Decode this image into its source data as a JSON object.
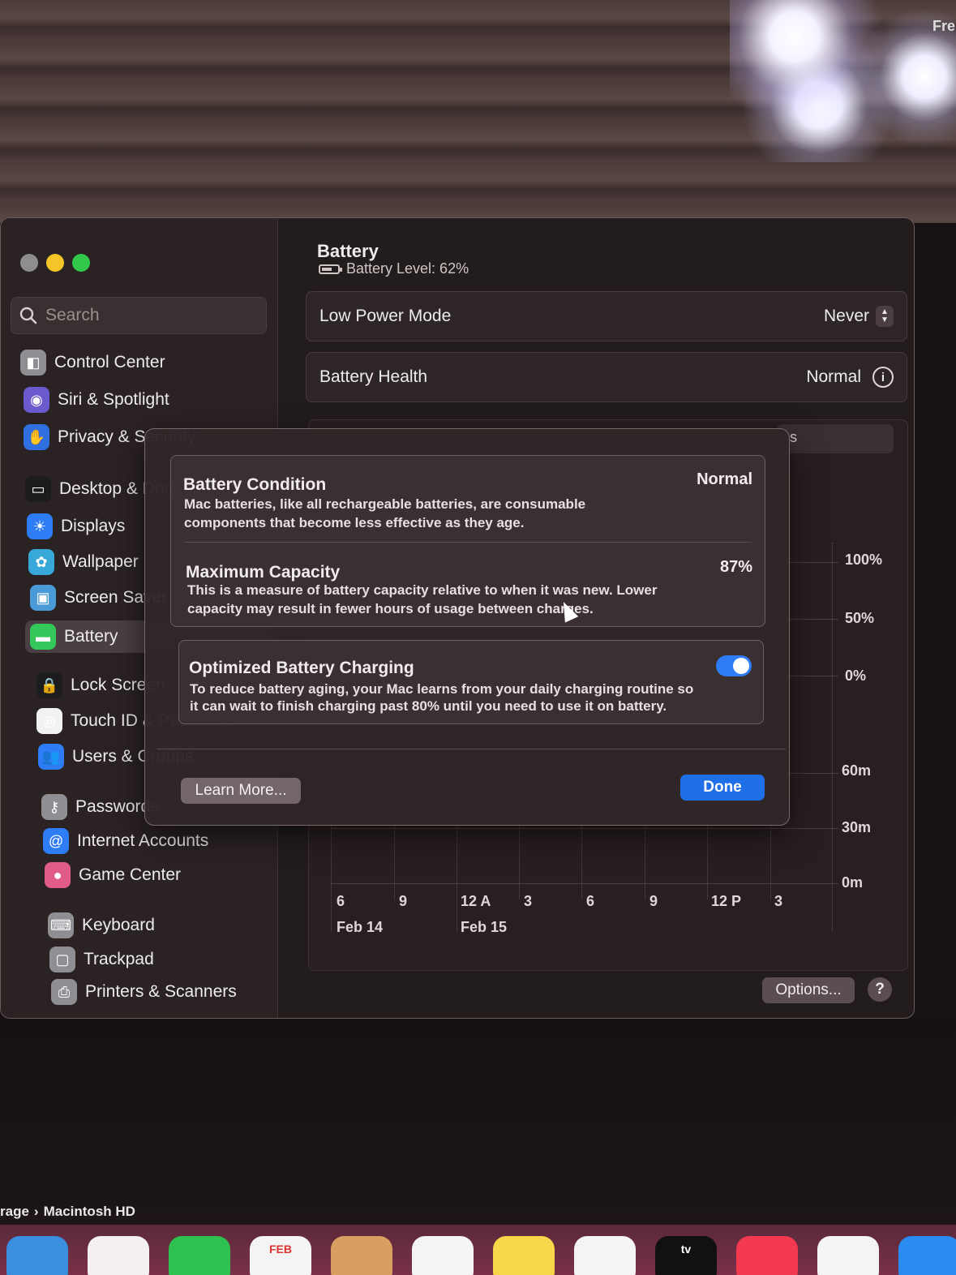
{
  "background": {
    "corner_text": "Fre",
    "finder_path": [
      "rage",
      "Macintosh HD"
    ],
    "finder_separator": "›"
  },
  "dock": {
    "items": [
      {
        "name": "maps-icon",
        "glyph": "",
        "color": "#3a8fe0"
      },
      {
        "name": "photos-icon",
        "glyph": "",
        "color": "#f5f0f0"
      },
      {
        "name": "facetime-icon",
        "glyph": "",
        "color": "#2fc14f"
      },
      {
        "name": "calendar-icon",
        "glyph": "FEB",
        "color": "#f4f4f4"
      },
      {
        "name": "contacts-icon",
        "glyph": "",
        "color": "#d8a060"
      },
      {
        "name": "reminders-icon",
        "glyph": "",
        "color": "#f4f4f4"
      },
      {
        "name": "notes-icon",
        "glyph": "",
        "color": "#f7d64a"
      },
      {
        "name": "freeform-icon",
        "glyph": "",
        "color": "#f4f4f4"
      },
      {
        "name": "apple-tv-icon",
        "glyph": "tv",
        "color": "#111111"
      },
      {
        "name": "music-icon",
        "glyph": "",
        "color": "#f2394f"
      },
      {
        "name": "news-icon",
        "glyph": "",
        "color": "#f4f4f4"
      },
      {
        "name": "app-store-icon",
        "glyph": "",
        "color": "#2a8cf0"
      }
    ]
  },
  "sidebar": {
    "search_placeholder": "Search",
    "items": [
      {
        "label": "Control Center",
        "icon": "control-center-icon",
        "color": "#8e8e93",
        "glyph": "◧"
      },
      {
        "label": "Siri & Spotlight",
        "icon": "siri-icon",
        "color": "#6a5acd",
        "glyph": "◉"
      },
      {
        "label": "Privacy & Security",
        "icon": "hand-icon",
        "color": "#2f6fe0",
        "glyph": "✋"
      },
      {
        "label": "Desktop & Dock",
        "icon": "dock-icon",
        "color": "#1c1c1e",
        "glyph": "▭"
      },
      {
        "label": "Displays",
        "icon": "sun-icon",
        "color": "#2f7df6",
        "glyph": "☀"
      },
      {
        "label": "Wallpaper",
        "icon": "wallpaper-icon",
        "color": "#38a8d8",
        "glyph": "✿"
      },
      {
        "label": "Screen Saver",
        "icon": "screen-saver-icon",
        "color": "#4a9ad8",
        "glyph": "▣"
      },
      {
        "label": "Battery",
        "icon": "battery-icon",
        "color": "#34c759",
        "glyph": "▬"
      },
      {
        "label": "Lock Screen",
        "icon": "lock-icon",
        "color": "#1c1c1e",
        "glyph": "🔒"
      },
      {
        "label": "Touch ID & Password",
        "icon": "fingerprint-icon",
        "color": "#f2f2f2",
        "glyph": "◎"
      },
      {
        "label": "Users & Groups",
        "icon": "users-icon",
        "color": "#2f7df6",
        "glyph": "👥"
      },
      {
        "label": "Passwords",
        "icon": "key-icon",
        "color": "#8e8e93",
        "glyph": "⚷"
      },
      {
        "label": "Internet Accounts",
        "icon": "at-icon",
        "color": "#2f7df6",
        "glyph": "@"
      },
      {
        "label": "Game Center",
        "icon": "game-center-icon",
        "color": "#e05a8a",
        "glyph": "●"
      },
      {
        "label": "Keyboard",
        "icon": "keyboard-icon",
        "color": "#8e8e93",
        "glyph": "⌨"
      },
      {
        "label": "Trackpad",
        "icon": "trackpad-icon",
        "color": "#8e8e93",
        "glyph": "▢"
      },
      {
        "label": "Printers & Scanners",
        "icon": "printer-icon",
        "color": "#8e8e93",
        "glyph": "⎙"
      }
    ],
    "selected": "Battery"
  },
  "main": {
    "title": "Battery",
    "battery_level": "Battery Level: 62%",
    "low_power_mode": {
      "label": "Low Power Mode",
      "value": "Never"
    },
    "battery_health": {
      "label": "Battery Health",
      "value": "Normal"
    },
    "segment_fragment": "s",
    "chart": {
      "level_axis": [
        "100%",
        "50%",
        "0%"
      ],
      "usage_axis": [
        "60m",
        "30m",
        "0m"
      ],
      "time_ticks": [
        "6",
        "9",
        "12 A",
        "3",
        "6",
        "9",
        "12 P",
        "3"
      ],
      "date_labels": [
        "Feb 14",
        "Feb 15"
      ]
    },
    "options_label": "Options...",
    "help_label": "?"
  },
  "sheet": {
    "condition": {
      "title": "Battery Condition",
      "value": "Normal",
      "desc_line1": "Mac batteries, like all rechargeable batteries, are consumable",
      "desc_line2": "components that become less effective as they age."
    },
    "capacity": {
      "title": "Maximum Capacity",
      "value": "87%",
      "desc_line1": "This is a measure of battery capacity relative to when it was new. Lower",
      "desc_line2": "capacity may result in fewer hours of usage between charges."
    },
    "optimized": {
      "title": "Optimized Battery Charging",
      "enabled": true,
      "desc_line1": "To reduce battery aging, your Mac learns from your daily charging routine so",
      "desc_line2": "it can wait to finish charging past 80% until you need to use it on battery."
    },
    "learn_more_label": "Learn More...",
    "done_label": "Done"
  }
}
